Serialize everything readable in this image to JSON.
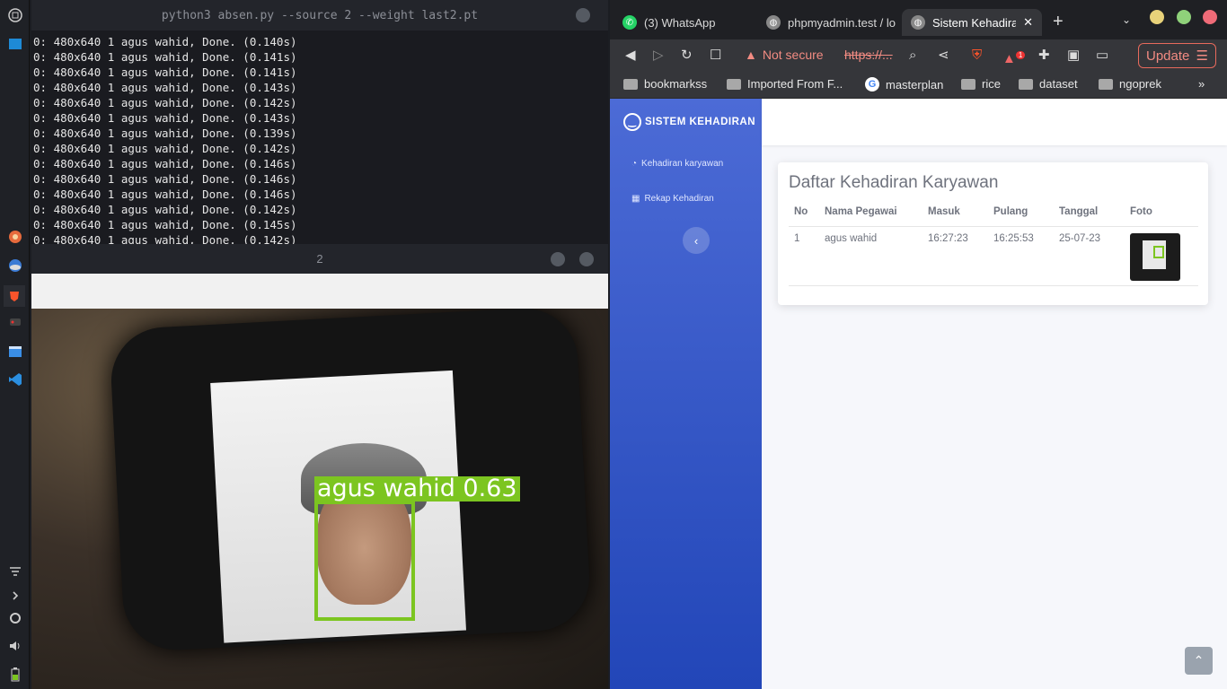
{
  "terminal": {
    "title": "python3 absen.py --source 2 --weight last2.pt",
    "lines": [
      "0: 480x640 1 agus wahid, Done. (0.140s)",
      "0: 480x640 1 agus wahid, Done. (0.141s)",
      "0: 480x640 1 agus wahid, Done. (0.141s)",
      "0: 480x640 1 agus wahid, Done. (0.143s)",
      "0: 480x640 1 agus wahid, Done. (0.142s)",
      "0: 480x640 1 agus wahid, Done. (0.143s)",
      "0: 480x640 1 agus wahid, Done. (0.139s)",
      "0: 480x640 1 agus wahid, Done. (0.142s)",
      "0: 480x640 1 agus wahid, Done. (0.146s)",
      "0: 480x640 1 agus wahid, Done. (0.146s)",
      "0: 480x640 1 agus wahid, Done. (0.146s)",
      "0: 480x640 1 agus wahid, Done. (0.142s)",
      "0: 480x640 1 agus wahid, Done. (0.145s)",
      "0: 480x640 1 agus wahid, Done. (0.142s)"
    ]
  },
  "camera": {
    "title": "2",
    "detection_label": "agus wahid 0.63",
    "box_color": "#7cc520"
  },
  "browser": {
    "tabs": [
      {
        "label": "(3) WhatsApp",
        "icon": "whatsapp-icon",
        "active": false
      },
      {
        "label": "phpmyadmin.test / lo",
        "icon": "globe-icon",
        "active": false
      },
      {
        "label": "Sistem Kehadiran",
        "icon": "globe-icon",
        "active": true
      }
    ],
    "not_secure": "Not secure",
    "url": "https://...",
    "update_label": "Update",
    "bookmarks": [
      {
        "label": "bookmarkss",
        "icon": "folder-icon"
      },
      {
        "label": "Imported From F...",
        "icon": "folder-icon"
      },
      {
        "label": "masterplan",
        "icon": "google-icon"
      },
      {
        "label": "rice",
        "icon": "folder-icon"
      },
      {
        "label": "dataset",
        "icon": "folder-icon"
      },
      {
        "label": "ngoprek",
        "icon": "folder-icon"
      }
    ],
    "extension_badge": "1"
  },
  "app": {
    "brand": "SISTEM KEHADIRAN",
    "nav": [
      {
        "label": "Kehadiran karyawan",
        "icon": "dashboard-icon"
      },
      {
        "label": "Rekap Kehadiran",
        "icon": "table-icon"
      }
    ],
    "card_title": "Daftar Kehadiran Karyawan",
    "columns": [
      "No",
      "Nama Pegawai",
      "Masuk",
      "Pulang",
      "Tanggal",
      "Foto"
    ],
    "rows": [
      {
        "no": "1",
        "nama": "agus wahid",
        "masuk": "16:27:23",
        "pulang": "16:25:53",
        "tanggal": "25-07-23"
      }
    ]
  }
}
